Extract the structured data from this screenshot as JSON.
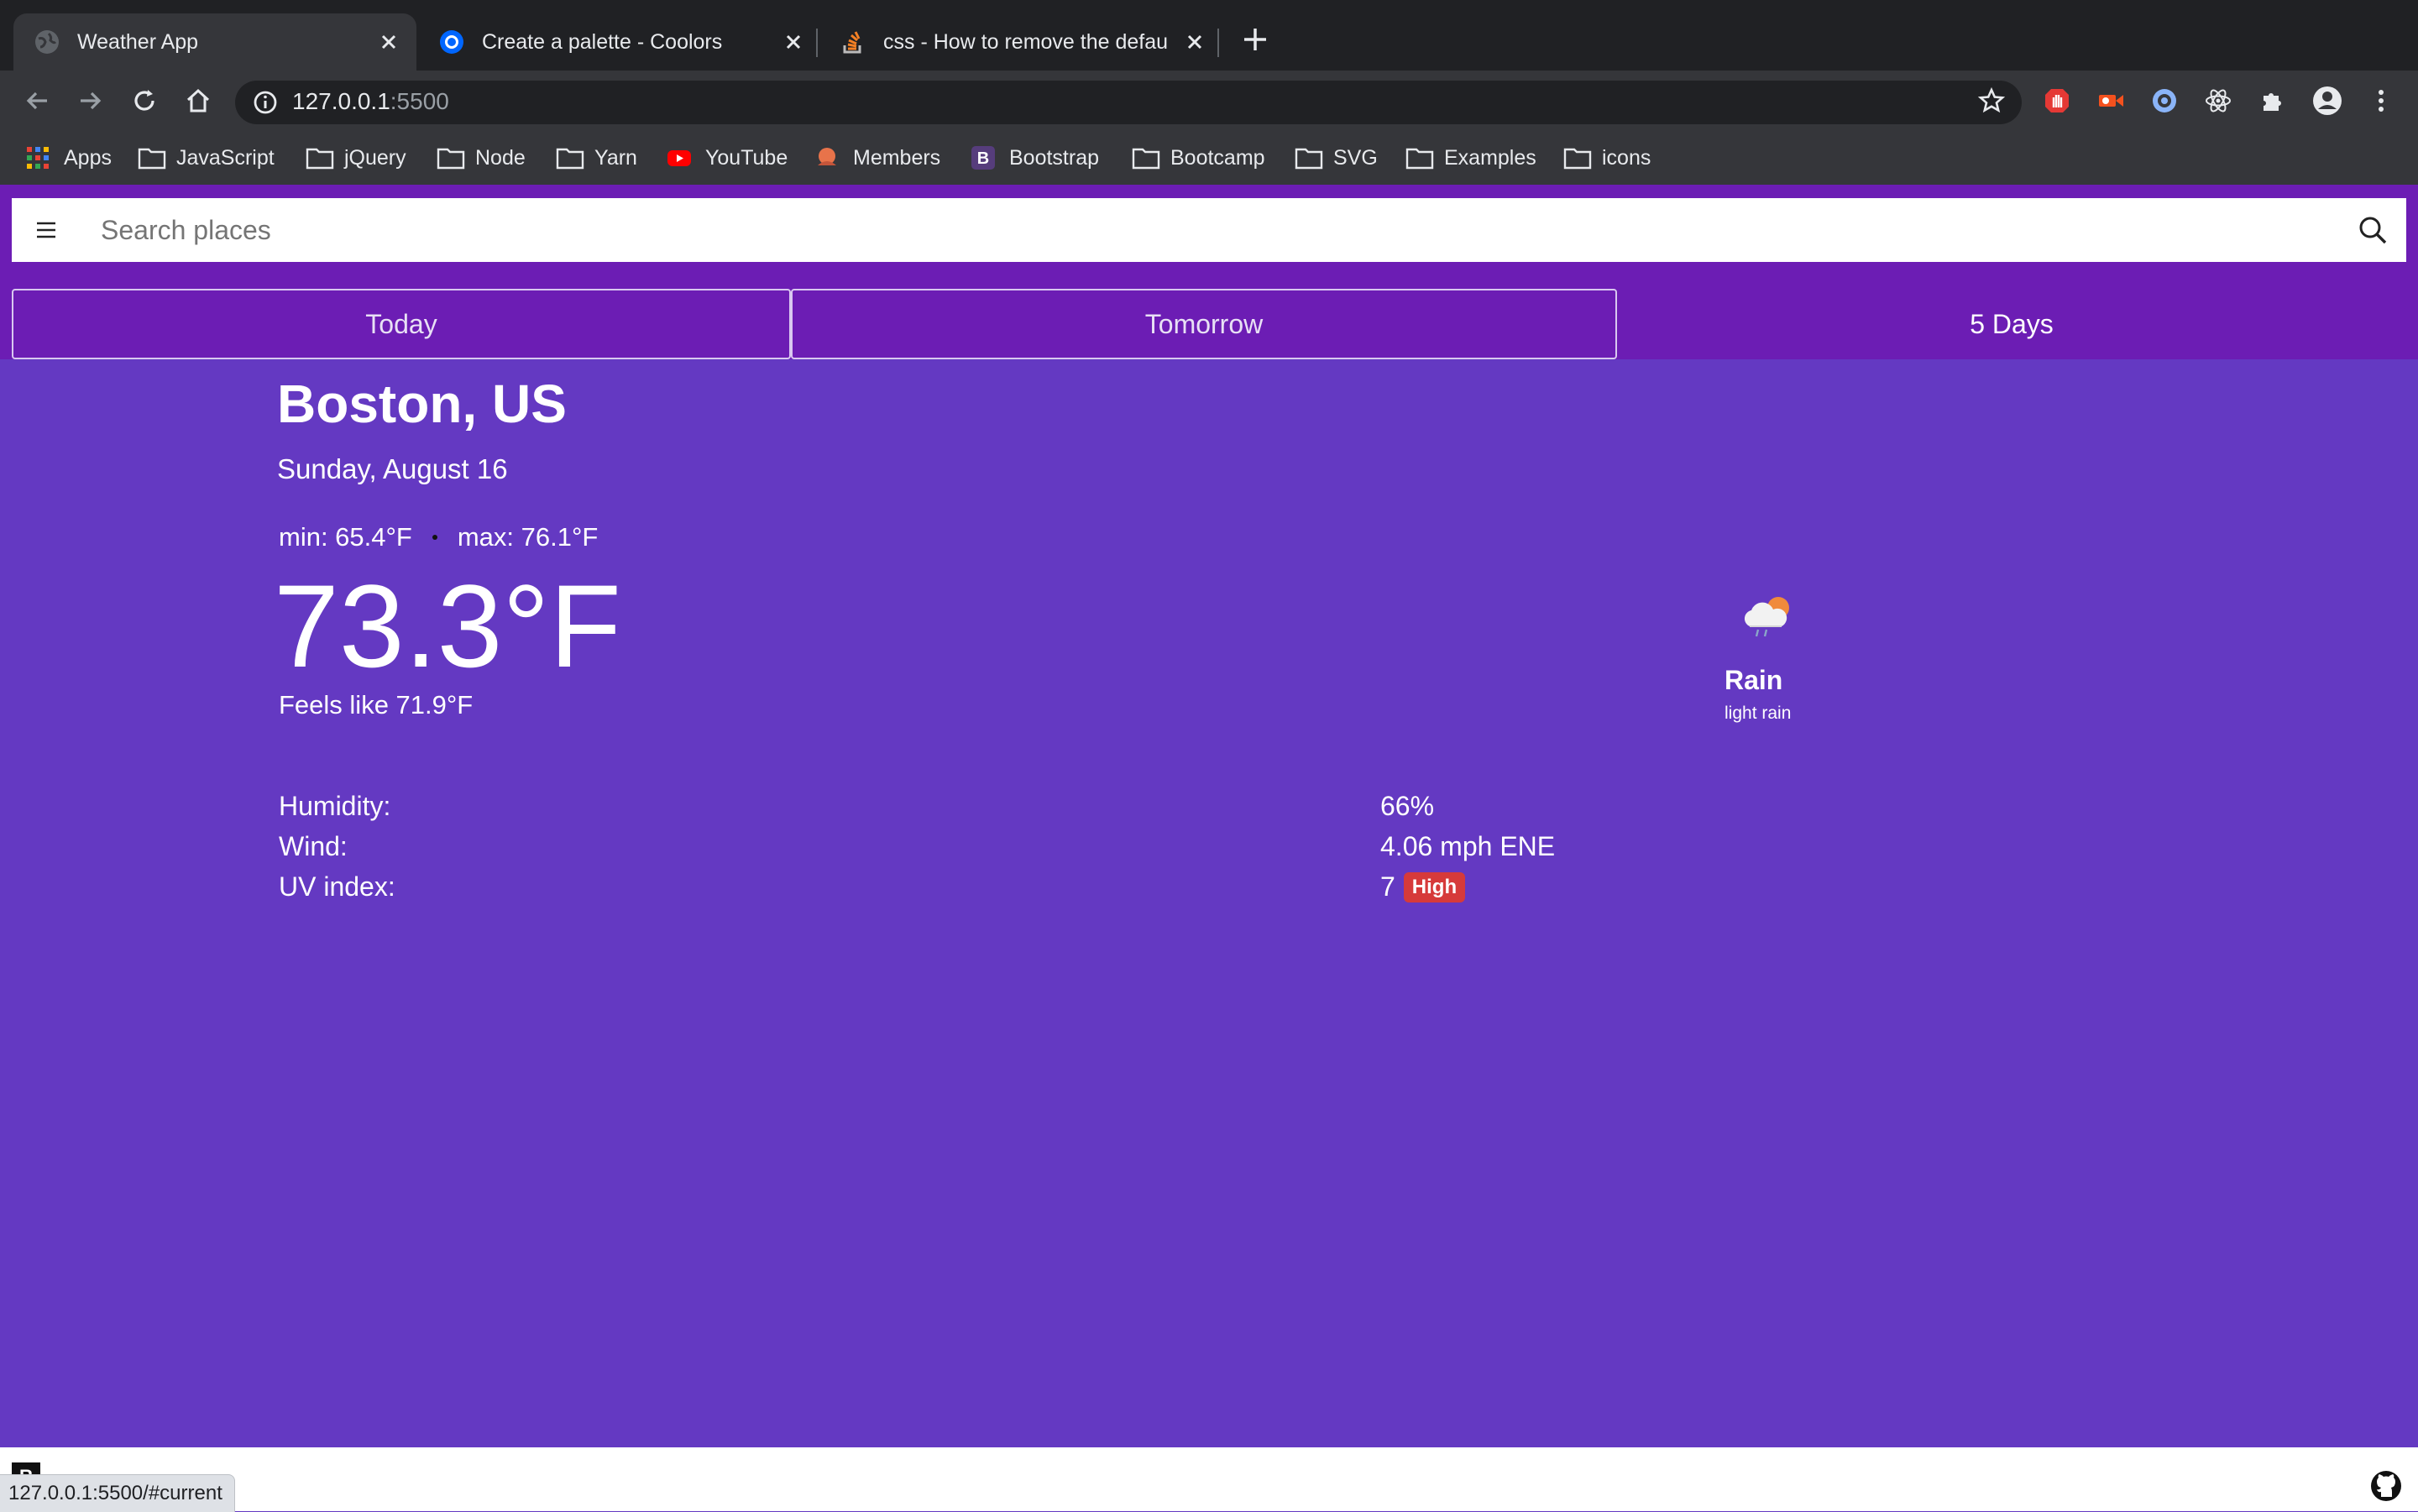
{
  "browser": {
    "tabs": [
      {
        "title": "Weather App",
        "active": true
      },
      {
        "title": "Create a palette - Coolors",
        "active": false
      },
      {
        "title": "css - How to remove the defau",
        "active": false
      }
    ],
    "address": {
      "host": "127.0.0.1",
      "port": ":5500"
    },
    "bookmarks": [
      "Apps",
      "JavaScript",
      "jQuery",
      "Node",
      "Yarn",
      "YouTube",
      "Members",
      "Bootstrap",
      "Bootcamp",
      "SVG",
      "Examples",
      "icons"
    ],
    "status_url": "127.0.0.1:5500/#current"
  },
  "app": {
    "search": {
      "placeholder": "Search places"
    },
    "tabs": [
      "Today",
      "Tomorrow",
      "5 Days"
    ],
    "location": "Boston, US",
    "date": "Sunday, August 16",
    "min": "min: 65.4°F",
    "max": "max: 76.1°F",
    "temperature": "73.3°F",
    "feels_like": "Feels like 71.9°F",
    "condition": {
      "main": "Rain",
      "description": "light rain",
      "icon": "cloud-sun-rain-icon"
    },
    "stats": [
      {
        "label": "Humidity:",
        "value": "66%"
      },
      {
        "label": "Wind:",
        "value": "4.06 mph ENE"
      },
      {
        "label": "UV index:",
        "value": "7",
        "badge": "High"
      }
    ]
  },
  "colors": {
    "page_bg": "#6439c2",
    "appbar_bg": "#6c1db4",
    "uv_high": "#d63a3a"
  }
}
